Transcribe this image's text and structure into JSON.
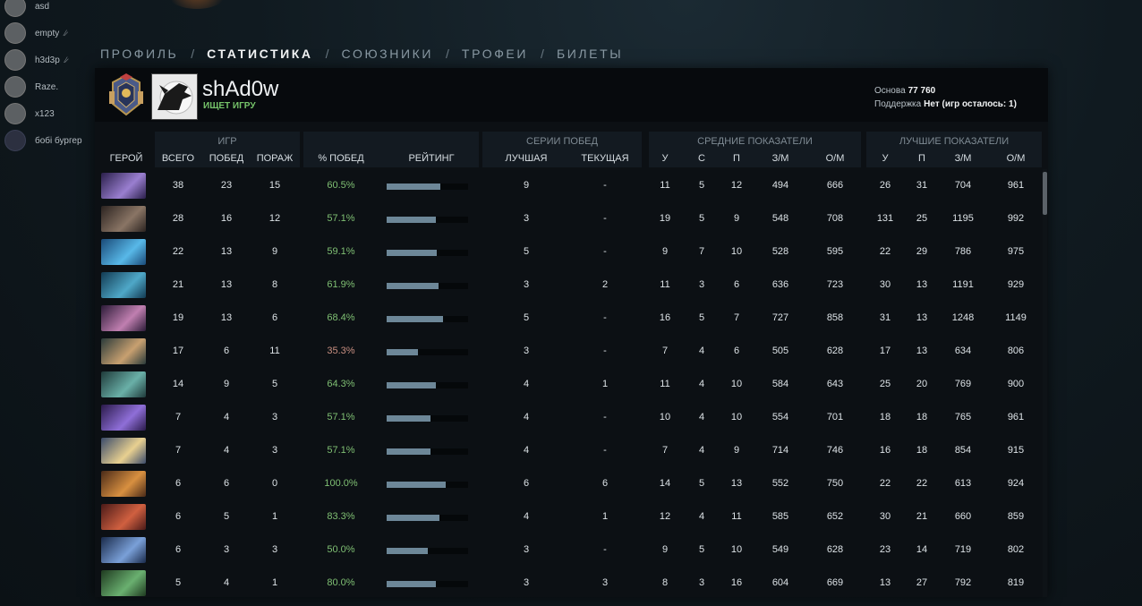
{
  "friends": [
    {
      "name": "asd",
      "muted": false,
      "dark": false
    },
    {
      "name": "empty",
      "muted": true,
      "dark": false
    },
    {
      "name": "h3d3p",
      "muted": true,
      "dark": false
    },
    {
      "name": "Raze.",
      "muted": false,
      "dark": false
    },
    {
      "name": "x123",
      "muted": false,
      "dark": false
    },
    {
      "name": "бобі бургер",
      "muted": false,
      "dark": true
    }
  ],
  "nav": {
    "profile": "ПРОФИЛЬ",
    "stats": "СТАТИСТИКА",
    "allies": "СОЮЗНИКИ",
    "trophies": "ТРОФЕИ",
    "tickets": "БИЛЕТЫ",
    "separator": "/"
  },
  "player": {
    "name": "shAd0w",
    "status": "ИЩЕТ ИГРУ"
  },
  "info": {
    "base_label": "Основа",
    "base_value": "77 760",
    "support_label": "Поддержка",
    "support_value": "Нет (игр осталось: 1)"
  },
  "groups": {
    "games": "ИГР",
    "streaks": "СЕРИИ ПОБЕД",
    "averages": "СРЕДНИЕ ПОКАЗАТЕЛИ",
    "best": "ЛУЧШИЕ ПОКАЗАТЕЛИ"
  },
  "columns": {
    "hero": "ГЕРОЙ",
    "total": "ВСЕГО",
    "wins": "ПОБЕД",
    "losses": "ПОРАЖ",
    "winrate": "% ПОБЕД",
    "rating": "РЕЙТИНГ",
    "best_streak": "ЛУЧШАЯ",
    "current_streak": "ТЕКУЩАЯ",
    "avg_k": "У",
    "avg_d": "С",
    "avg_a": "П",
    "avg_gpm": "З/М",
    "avg_xpm": "О/М",
    "best_k": "У",
    "best_a": "П",
    "best_gpm": "З/М",
    "best_xpm": "О/М"
  },
  "accent_colors": {
    "winrate_good": "#7fbf73",
    "winrate_bad": "#c78e80",
    "status": "#76c46a",
    "rating_bar": "#6d8798"
  },
  "rows": [
    {
      "hero_colors": [
        "#2a1f4a",
        "#9a7fd0"
      ],
      "total": "38",
      "wins": "23",
      "losses": "15",
      "winrate": "60.5%",
      "rating": 0.66,
      "best_streak": "9",
      "current_streak": "-",
      "avg_k": "11",
      "avg_d": "5",
      "avg_a": "12",
      "avg_gpm": "494",
      "avg_xpm": "666",
      "best_k": "26",
      "best_a": "31",
      "best_gpm": "704",
      "best_xpm": "961"
    },
    {
      "hero_colors": [
        "#2b2320",
        "#8a7565"
      ],
      "total": "28",
      "wins": "16",
      "losses": "12",
      "winrate": "57.1%",
      "rating": 0.6,
      "best_streak": "3",
      "current_streak": "-",
      "avg_k": "19",
      "avg_d": "5",
      "avg_a": "9",
      "avg_gpm": "548",
      "avg_xpm": "708",
      "best_k": "131",
      "best_a": "25",
      "best_gpm": "1195",
      "best_xpm": "992"
    },
    {
      "hero_colors": [
        "#1a4a78",
        "#58b8e8"
      ],
      "total": "22",
      "wins": "13",
      "losses": "9",
      "winrate": "59.1%",
      "rating": 0.61,
      "best_streak": "5",
      "current_streak": "-",
      "avg_k": "9",
      "avg_d": "7",
      "avg_a": "10",
      "avg_gpm": "528",
      "avg_xpm": "595",
      "best_k": "22",
      "best_a": "29",
      "best_gpm": "786",
      "best_xpm": "975"
    },
    {
      "hero_colors": [
        "#123a52",
        "#4fa8c8"
      ],
      "total": "21",
      "wins": "13",
      "losses": "8",
      "winrate": "61.9%",
      "rating": 0.64,
      "best_streak": "3",
      "current_streak": "2",
      "avg_k": "11",
      "avg_d": "3",
      "avg_a": "6",
      "avg_gpm": "636",
      "avg_xpm": "723",
      "best_k": "30",
      "best_a": "13",
      "best_gpm": "1191",
      "best_xpm": "929"
    },
    {
      "hero_colors": [
        "#2c1b38",
        "#c07fb0"
      ],
      "total": "19",
      "wins": "13",
      "losses": "6",
      "winrate": "68.4%",
      "rating": 0.69,
      "best_streak": "5",
      "current_streak": "-",
      "avg_k": "16",
      "avg_d": "5",
      "avg_a": "7",
      "avg_gpm": "727",
      "avg_xpm": "858",
      "best_k": "31",
      "best_a": "13",
      "best_gpm": "1248",
      "best_xpm": "1149"
    },
    {
      "hero_colors": [
        "#2a3a3a",
        "#c8a070"
      ],
      "total": "17",
      "wins": "6",
      "losses": "11",
      "winrate": "35.3%",
      "rating": 0.38,
      "best_streak": "3",
      "current_streak": "-",
      "avg_k": "7",
      "avg_d": "4",
      "avg_a": "6",
      "avg_gpm": "505",
      "avg_xpm": "628",
      "best_k": "17",
      "best_a": "13",
      "best_gpm": "634",
      "best_xpm": "806"
    },
    {
      "hero_colors": [
        "#1f3a3a",
        "#6ab0a8"
      ],
      "total": "14",
      "wins": "9",
      "losses": "5",
      "winrate": "64.3%",
      "rating": 0.6,
      "best_streak": "4",
      "current_streak": "1",
      "avg_k": "11",
      "avg_d": "4",
      "avg_a": "10",
      "avg_gpm": "584",
      "avg_xpm": "643",
      "best_k": "25",
      "best_a": "20",
      "best_gpm": "769",
      "best_xpm": "900"
    },
    {
      "hero_colors": [
        "#2a1a4a",
        "#8f6fd8"
      ],
      "total": "7",
      "wins": "4",
      "losses": "3",
      "winrate": "57.1%",
      "rating": 0.54,
      "best_streak": "4",
      "current_streak": "-",
      "avg_k": "10",
      "avg_d": "4",
      "avg_a": "10",
      "avg_gpm": "554",
      "avg_xpm": "701",
      "best_k": "18",
      "best_a": "18",
      "best_gpm": "765",
      "best_xpm": "961"
    },
    {
      "hero_colors": [
        "#3a4a6a",
        "#e8d090"
      ],
      "total": "7",
      "wins": "4",
      "losses": "3",
      "winrate": "57.1%",
      "rating": 0.54,
      "best_streak": "4",
      "current_streak": "-",
      "avg_k": "7",
      "avg_d": "4",
      "avg_a": "9",
      "avg_gpm": "714",
      "avg_xpm": "746",
      "best_k": "16",
      "best_a": "18",
      "best_gpm": "854",
      "best_xpm": "915"
    },
    {
      "hero_colors": [
        "#4a2a18",
        "#d89040"
      ],
      "total": "6",
      "wins": "6",
      "losses": "0",
      "winrate": "100.0%",
      "rating": 0.72,
      "best_streak": "6",
      "current_streak": "6",
      "avg_k": "14",
      "avg_d": "5",
      "avg_a": "13",
      "avg_gpm": "552",
      "avg_xpm": "750",
      "best_k": "22",
      "best_a": "22",
      "best_gpm": "613",
      "best_xpm": "924"
    },
    {
      "hero_colors": [
        "#4a1a18",
        "#d06040"
      ],
      "total": "6",
      "wins": "5",
      "losses": "1",
      "winrate": "83.3%",
      "rating": 0.65,
      "best_streak": "4",
      "current_streak": "1",
      "avg_k": "12",
      "avg_d": "4",
      "avg_a": "11",
      "avg_gpm": "585",
      "avg_xpm": "652",
      "best_k": "30",
      "best_a": "21",
      "best_gpm": "660",
      "best_xpm": "859"
    },
    {
      "hero_colors": [
        "#1a2a4a",
        "#7aa0d8"
      ],
      "total": "6",
      "wins": "3",
      "losses": "3",
      "winrate": "50.0%",
      "rating": 0.5,
      "best_streak": "3",
      "current_streak": "-",
      "avg_k": "9",
      "avg_d": "5",
      "avg_a": "10",
      "avg_gpm": "549",
      "avg_xpm": "628",
      "best_k": "23",
      "best_a": "14",
      "best_gpm": "719",
      "best_xpm": "802"
    },
    {
      "hero_colors": [
        "#1f3a20",
        "#6ab070"
      ],
      "total": "5",
      "wins": "4",
      "losses": "1",
      "winrate": "80.0%",
      "rating": 0.6,
      "best_streak": "3",
      "current_streak": "3",
      "avg_k": "8",
      "avg_d": "3",
      "avg_a": "16",
      "avg_gpm": "604",
      "avg_xpm": "669",
      "best_k": "13",
      "best_a": "27",
      "best_gpm": "792",
      "best_xpm": "819"
    }
  ]
}
